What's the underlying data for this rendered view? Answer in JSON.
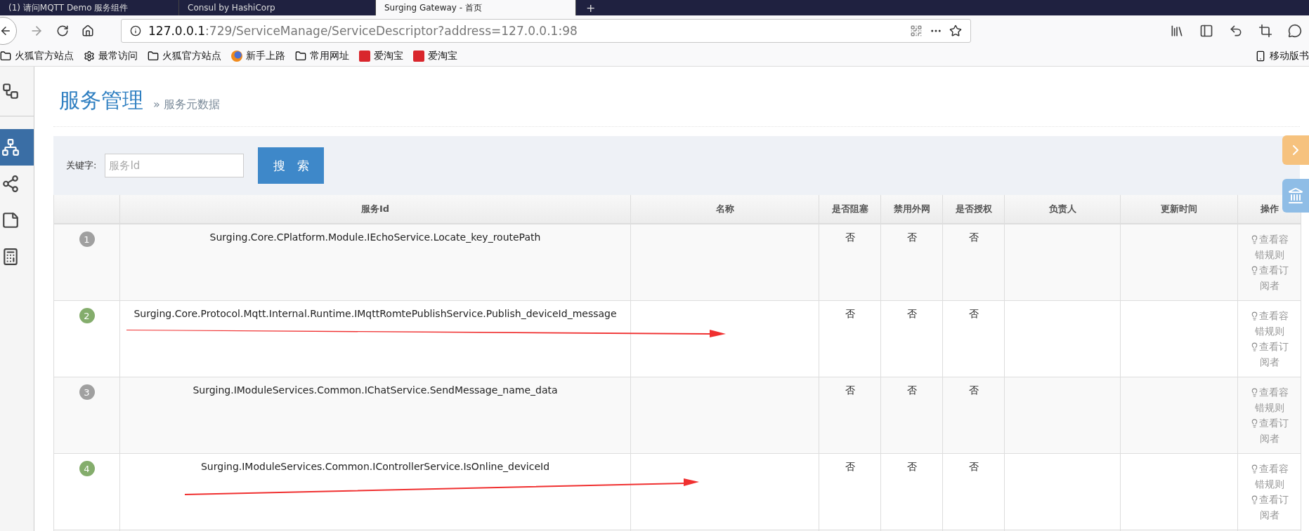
{
  "browser": {
    "tabs": [
      {
        "title": "(1) 请问MQTT Demo 服务组件",
        "selected": false
      },
      {
        "title": "Consul by HashiCorp",
        "selected": false
      },
      {
        "title": "Surging Gateway - 首页",
        "selected": true
      }
    ],
    "new_tab": "+",
    "url": {
      "host": "127.0.0.1",
      "path": ":729/ServiceManage/ServiceDescriptor?address=127.0.0.1:98"
    },
    "bookmarks": [
      {
        "kind": "folder",
        "label": "火狐官方站点"
      },
      {
        "kind": "gear",
        "label": "最常访问"
      },
      {
        "kind": "folder",
        "label": "火狐官方站点"
      },
      {
        "kind": "firefox",
        "label": "新手上路"
      },
      {
        "kind": "folder",
        "label": "常用网址"
      },
      {
        "kind": "taobao",
        "label": "爱淘宝"
      },
      {
        "kind": "taobao",
        "label": "爱淘宝"
      }
    ],
    "mobile_bookmarks": "移动版书"
  },
  "sidebar": {
    "items": [
      {
        "kind": "nodes",
        "selected": false
      },
      {
        "kind": "tree",
        "selected": true
      },
      {
        "kind": "share",
        "selected": false
      },
      {
        "kind": "note",
        "selected": false
      },
      {
        "kind": "calc",
        "selected": false
      }
    ]
  },
  "page": {
    "title": "服务管理",
    "breadcrumb": "» 服务元数据"
  },
  "search": {
    "label": "关键字:",
    "placeholder": "服务Id",
    "button": "搜　索"
  },
  "table": {
    "columns": [
      "",
      "服务Id",
      "名称",
      "是否阻塞",
      "禁用外网",
      "是否授权",
      "负责人",
      "更新时间",
      "操作"
    ],
    "rows": [
      {
        "index": "1",
        "color": "#a0a0a0",
        "service_id": "Surging.Core.CPlatform.Module.IEchoService.Locate_key_routePath",
        "blocked": "否",
        "no_external": "否",
        "authorized": "否",
        "actions": [
          "查看容错规则",
          "查看订阅者"
        ]
      },
      {
        "index": "2",
        "color": "#84ad6c",
        "service_id": "Surging.Core.Protocol.Mqtt.Internal.Runtime.IMqttRomtePublishService.Publish_deviceId_message",
        "blocked": "否",
        "no_external": "否",
        "authorized": "否",
        "actions": [
          "查看容错规则",
          "查看订阅者"
        ],
        "arrow": true
      },
      {
        "index": "3",
        "color": "#a0a0a0",
        "service_id": "Surging.IModuleServices.Common.IChatService.SendMessage_name_data",
        "blocked": "否",
        "no_external": "否",
        "authorized": "否",
        "actions": [
          "查看容错规则",
          "查看订阅者"
        ]
      },
      {
        "index": "4",
        "color": "#84ad6c",
        "service_id": "Surging.IModuleServices.Common.IControllerService.IsOnline_deviceId",
        "blocked": "否",
        "no_external": "否",
        "authorized": "否",
        "actions": [
          "查看容错规则",
          "查看订阅者"
        ],
        "arrow": true
      }
    ]
  }
}
